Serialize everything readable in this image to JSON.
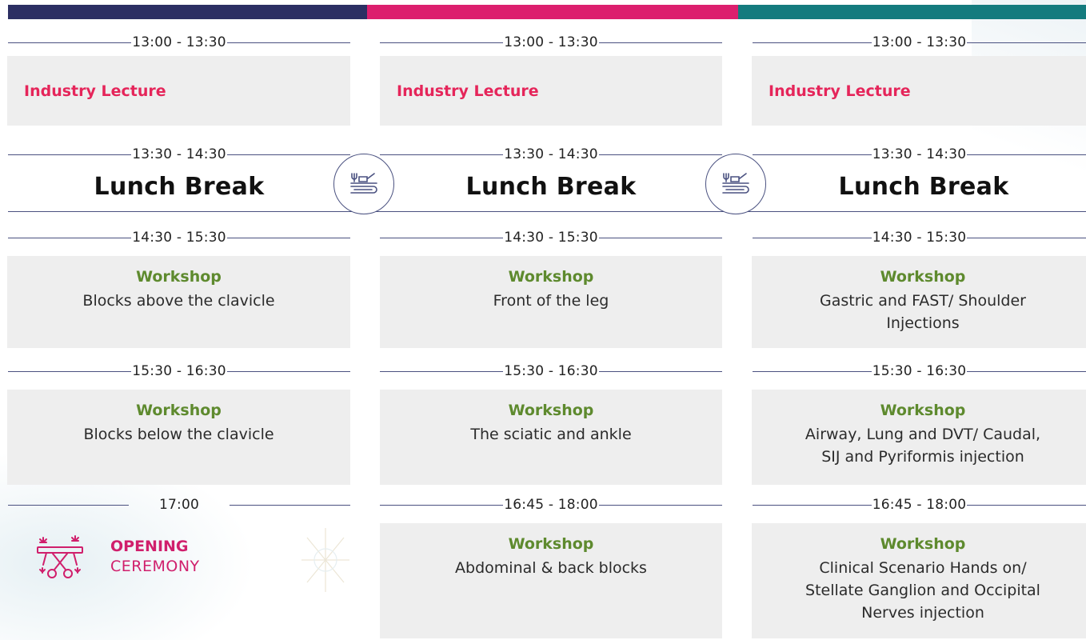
{
  "columns": [
    {
      "accent": "#2c2f63",
      "slots": [
        {
          "time": "13:00 - 13:30",
          "title": "Industry Lecture"
        },
        {
          "time": "13:30 - 14:30",
          "title": "Lunch Break"
        },
        {
          "time": "14:30 - 15:30",
          "title": "Workshop",
          "desc": "Blocks above the clavicle"
        },
        {
          "time": "15:30 - 16:30",
          "title": "Workshop",
          "desc": "Blocks below the clavicle"
        },
        {
          "time": "17:00",
          "title": "OPENING",
          "desc": "CEREMONY"
        }
      ]
    },
    {
      "accent": "#dc1f6e",
      "slots": [
        {
          "time": "13:00 - 13:30",
          "title": "Industry Lecture"
        },
        {
          "time": "13:30 - 14:30",
          "title": "Lunch Break"
        },
        {
          "time": "14:30 - 15:30",
          "title": "Workshop",
          "desc": "Front of the leg"
        },
        {
          "time": "15:30 - 16:30",
          "title": "Workshop",
          "desc": "The sciatic and ankle"
        },
        {
          "time": "16:45 - 18:00",
          "title": "Workshop",
          "desc": "Abdominal & back blocks"
        }
      ]
    },
    {
      "accent": "#147b7e",
      "slots": [
        {
          "time": "13:00 - 13:30",
          "title": "Industry Lecture"
        },
        {
          "time": "13:30 - 14:30",
          "title": "Lunch Break"
        },
        {
          "time": "14:30 - 15:30",
          "title": "Workshop",
          "desc_lines": [
            "Gastric and FAST/ Shoulder",
            "Injections"
          ]
        },
        {
          "time": "15:30 - 16:30",
          "title": "Workshop",
          "desc_lines": [
            "Airway, Lung and DVT/ Caudal,",
            "SIJ and Pyriformis injection"
          ]
        },
        {
          "time": "16:45 - 18:00",
          "title": "Workshop",
          "desc_lines": [
            "Clinical Scenario Hands on/",
            "Stellate Ganglion and Occipital",
            "Nerves injection"
          ]
        }
      ]
    }
  ],
  "icons": {
    "lunch": "food-tray-icon",
    "opening": "ribbon-cutting-scissors-icon"
  },
  "colors": {
    "industry": "#e5255a",
    "workshop": "#5e8a2e",
    "opening": "#d01f6c",
    "box": "#eeeeee",
    "line": "#4a5180"
  }
}
